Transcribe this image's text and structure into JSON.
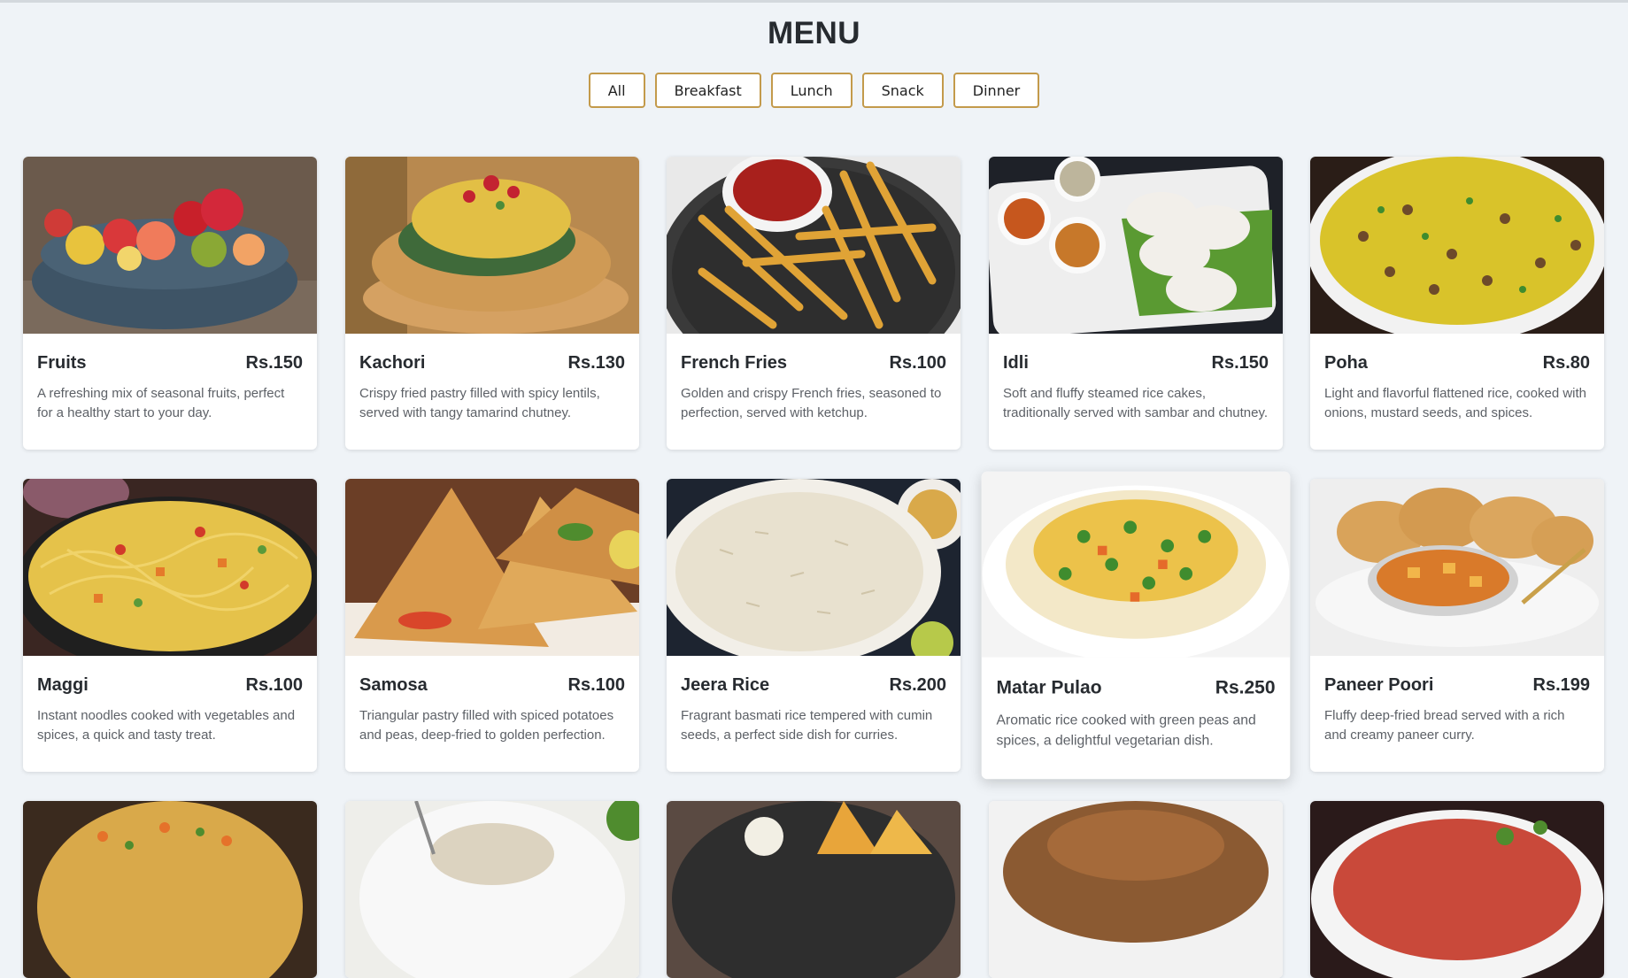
{
  "page": {
    "title": "MENU"
  },
  "filters": [
    "All",
    "Breakfast",
    "Lunch",
    "Snack",
    "Dinner"
  ],
  "menu": [
    {
      "name": "Fruits",
      "price": "Rs.150",
      "desc": "A refreshing mix of seasonal fruits, perfect for a healthy start to your day.",
      "photo": "fruits-bowl-photo"
    },
    {
      "name": "Kachori",
      "price": "Rs.130",
      "desc": "Crispy fried pastry filled with spicy lentils, served with tangy tamarind chutney.",
      "photo": "kachori-photo"
    },
    {
      "name": "French Fries",
      "price": "Rs.100",
      "desc": "Golden and crispy French fries, seasoned to perfection, served with ketchup.",
      "photo": "french-fries-photo"
    },
    {
      "name": "Idli",
      "price": "Rs.150",
      "desc": "Soft and fluffy steamed rice cakes, traditionally served with sambar and chutney.",
      "photo": "idli-photo"
    },
    {
      "name": "Poha",
      "price": "Rs.80",
      "desc": "Light and flavorful flattened rice, cooked with onions, mustard seeds, and spices.",
      "photo": "poha-photo"
    },
    {
      "name": "Maggi",
      "price": "Rs.100",
      "desc": "Instant noodles cooked with vegetables and spices, a quick and tasty treat.",
      "photo": "maggi-photo"
    },
    {
      "name": "Samosa",
      "price": "Rs.100",
      "desc": "Triangular pastry filled with spiced potatoes and peas, deep-fried to golden perfection.",
      "photo": "samosa-photo"
    },
    {
      "name": "Jeera Rice",
      "price": "Rs.200",
      "desc": "Fragrant basmati rice tempered with cumin seeds, a perfect side dish for curries.",
      "photo": "jeera-rice-photo"
    },
    {
      "name": "Matar Pulao",
      "price": "Rs.250",
      "desc": "Aromatic rice cooked with green peas and spices, a delightful vegetarian dish.",
      "photo": "matar-pulao-photo"
    },
    {
      "name": "Paneer Poori",
      "price": "Rs.199",
      "desc": "Fluffy deep-fried bread served with a rich and creamy paneer curry.",
      "photo": "paneer-poori-photo"
    }
  ],
  "partial_row_photos": [
    "upma-photo",
    "sandwich-photo",
    "dosa-photo",
    "chicken-photo",
    "salad-photo"
  ],
  "colors": {
    "accent": "#c39a4b",
    "background": "#eff3f7",
    "card": "#ffffff",
    "text": "#272b30",
    "muted": "#5d6167"
  }
}
